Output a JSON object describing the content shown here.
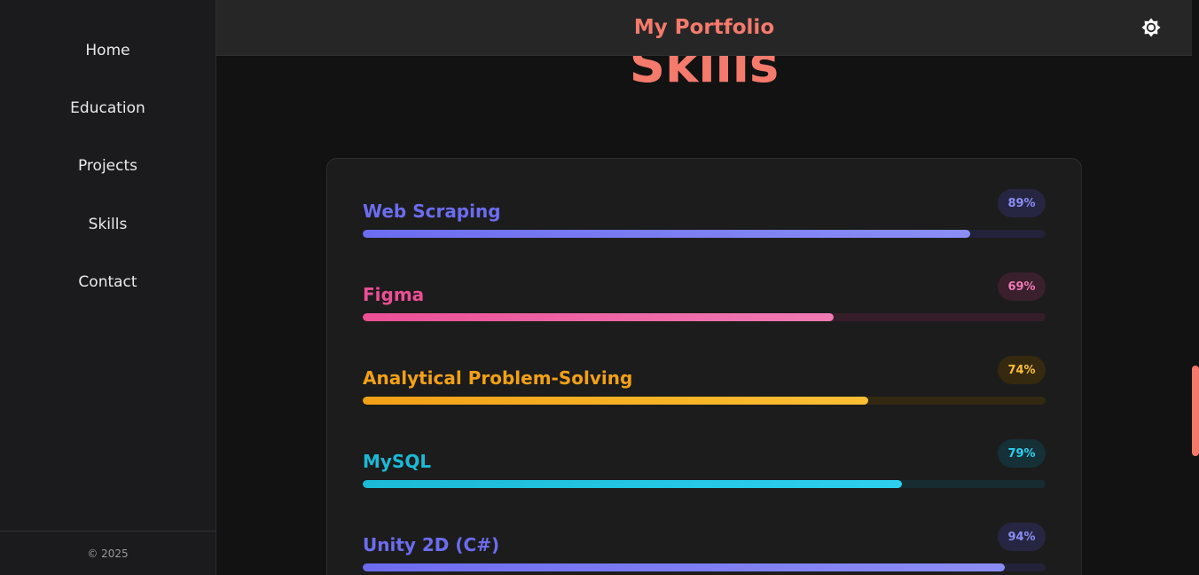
{
  "sidebar": {
    "items": [
      {
        "label": "Home"
      },
      {
        "label": "Education"
      },
      {
        "label": "Projects"
      },
      {
        "label": "Skills"
      },
      {
        "label": "Contact"
      }
    ],
    "footer": "© 2025"
  },
  "header": {
    "title": "My Portfolio",
    "theme_icon": "sun-icon"
  },
  "section": {
    "title": "Skills"
  },
  "colors": {
    "accent": "#f47a6c"
  },
  "skills": [
    {
      "name": "Web Scraping",
      "percent_label": "89%",
      "value": 89,
      "color": "#6c6cf0",
      "color_end": "#8a8ef4",
      "track": "#22223a",
      "badge_bg": "#262643"
    },
    {
      "name": "Figma",
      "percent_label": "69%",
      "value": 69,
      "color": "#ec4f95",
      "color_end": "#f07ab4",
      "track": "#351d2a",
      "badge_bg": "#3a1f2d"
    },
    {
      "name": "Analytical Problem-Solving",
      "percent_label": "74%",
      "value": 74,
      "color": "#f2a116",
      "color_end": "#fbbf34",
      "track": "#332812",
      "badge_bg": "#35290f"
    },
    {
      "name": "MySQL",
      "percent_label": "79%",
      "value": 79,
      "color": "#1bbad6",
      "color_end": "#2cd0ee",
      "track": "#172c30",
      "badge_bg": "#153037"
    },
    {
      "name": "Unity 2D (C#)",
      "percent_label": "94%",
      "value": 94,
      "color": "#6c6cf0",
      "color_end": "#8a8ef4",
      "track": "#22223a",
      "badge_bg": "#262643"
    }
  ]
}
